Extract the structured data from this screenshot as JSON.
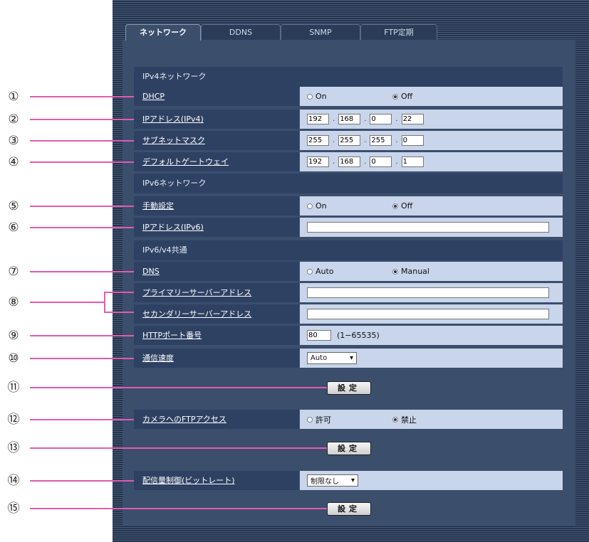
{
  "tabs": [
    "ネットワーク",
    "DDNS",
    "SNMP",
    "FTP定期"
  ],
  "sections": {
    "ipv4": "IPv4ネットワーク",
    "ipv6": "IPv6ネットワーク",
    "common": "IPv6/v4共通"
  },
  "rows": {
    "dhcp": {
      "label": "DHCP",
      "opt1": "On",
      "opt2": "Off",
      "selected": "Off"
    },
    "ipv4_addr": {
      "label": "IPアドレス(IPv4)",
      "octets": [
        "192",
        "168",
        "0",
        "22"
      ]
    },
    "subnet": {
      "label": "サブネットマスク",
      "octets": [
        "255",
        "255",
        "255",
        "0"
      ]
    },
    "gateway": {
      "label": "デフォルトゲートウェイ",
      "octets": [
        "192",
        "168",
        "0",
        "1"
      ]
    },
    "manual": {
      "label": "手動設定",
      "opt1": "On",
      "opt2": "Off",
      "selected": "Off"
    },
    "ipv6_addr": {
      "label": "IPアドレス(IPv6)",
      "value": ""
    },
    "dns": {
      "label": "DNS",
      "opt1": "Auto",
      "opt2": "Manual",
      "selected": "Manual"
    },
    "primary": {
      "label": "プライマリーサーバーアドレス",
      "value": ""
    },
    "secondary": {
      "label": "セカンダリーサーバーアドレス",
      "value": ""
    },
    "http_port": {
      "label": "HTTPポート番号",
      "value": "80",
      "range": "(1−65535)"
    },
    "speed": {
      "label": "通信速度",
      "value": "Auto"
    },
    "ftp": {
      "label": "カメラへのFTPアクセス",
      "opt1": "許可",
      "opt2": "禁止",
      "selected": "禁止"
    },
    "bitrate": {
      "label": "配信量制御(ビットレート)",
      "value": "制限なし"
    }
  },
  "set_button": "設定",
  "callouts": [
    "①",
    "②",
    "③",
    "④",
    "⑤",
    "⑥",
    "⑦",
    "⑧",
    "⑨",
    "⑩",
    "⑪",
    "⑫",
    "⑬",
    "⑭",
    "⑮"
  ],
  "colors": {
    "leader": "#e25bb1",
    "label_bg": "#2f4163",
    "value_bg": "#c8d5ea"
  }
}
